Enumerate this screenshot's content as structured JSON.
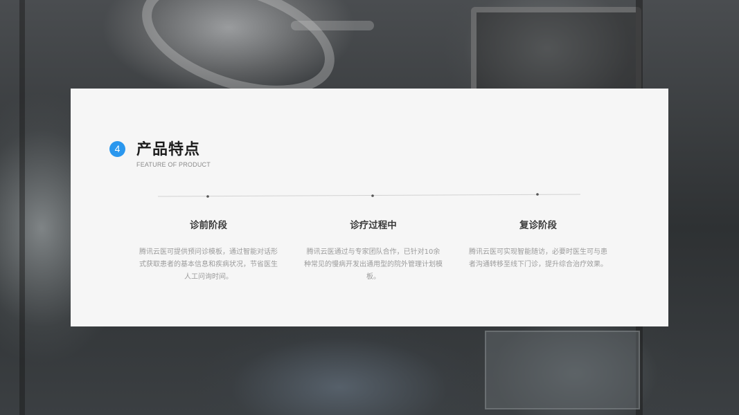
{
  "section": {
    "number": "4",
    "title": "产品特点",
    "subtitle": "FEATURE OF PRODUCT"
  },
  "stages": [
    {
      "title": "诊前阶段",
      "description": "腾讯云医可提供预问诊模板，通过智能对话形式获取患者的基本信息和疾病状况，节省医生人工问询时间。"
    },
    {
      "title": "诊疗过程中",
      "description": "腾讯云医通过与专家团队合作，已针对10余种常见的慢病开发出通用型的院外管理计划模板。"
    },
    {
      "title": "复诊阶段",
      "description": "腾讯云医可实现智能随访，必要时医生可与患者沟通转移至线下门诊，提升综合治疗效果。"
    }
  ],
  "colors": {
    "accent": "#2a97ee",
    "card": "#f6f6f6",
    "title": "#1e1e1e",
    "muted": "#9b9b9b"
  }
}
